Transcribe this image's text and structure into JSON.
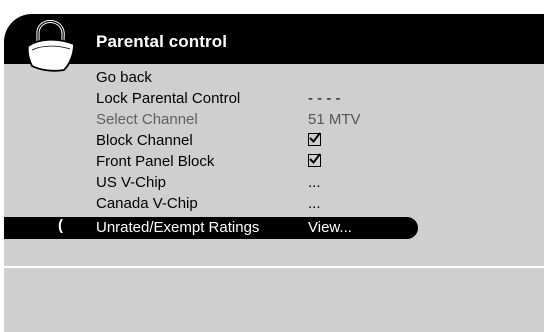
{
  "header": {
    "title": "Parental control"
  },
  "icons": {
    "lock": "padlock-icon",
    "check": "checkbox-checked-icon"
  },
  "menu": [
    {
      "label": "Go back",
      "value": ""
    },
    {
      "label": "Lock Parental Control",
      "value": "- - - -"
    },
    {
      "label": "Select Channel",
      "value": "51 MTV",
      "disabled": true
    },
    {
      "label": "Block Channel",
      "value": "",
      "checked": true
    },
    {
      "label": "Front Panel Block",
      "value": "",
      "checked": true
    },
    {
      "label": "US V-Chip",
      "value": "..."
    },
    {
      "label": "Canada V-Chip",
      "value": "..."
    },
    {
      "label": "Unrated/Exempt Ratings",
      "value": "View...",
      "selected": true,
      "cursor": "("
    }
  ],
  "colors": {
    "background": "#cfcfcf",
    "header": "#000000",
    "highlight": "#000000",
    "text": "#000000",
    "disabled_text": "#606060"
  }
}
